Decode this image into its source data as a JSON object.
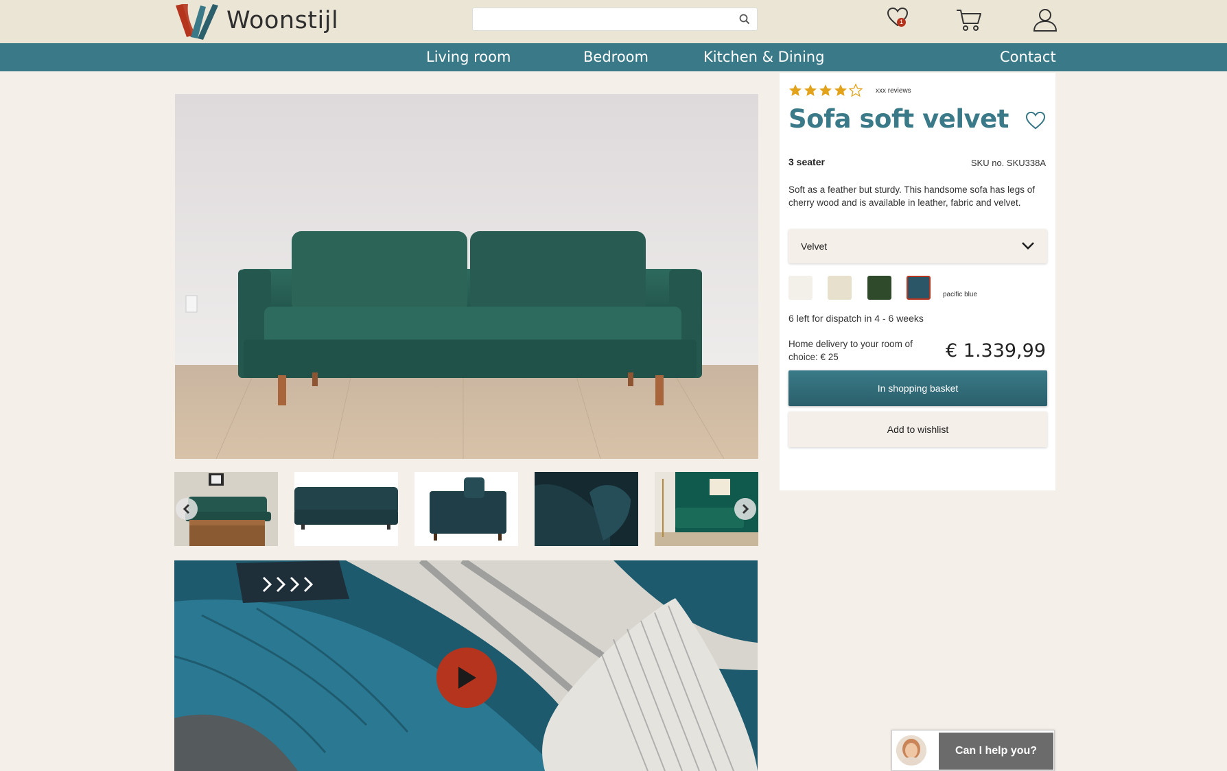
{
  "header": {
    "logo_text": "Woonstijl",
    "search": {
      "placeholder": "",
      "value": ""
    },
    "wishlist_count": "1",
    "icons": [
      "heart-icon",
      "cart-icon",
      "user-icon",
      "search-icon"
    ]
  },
  "nav": {
    "items": [
      "Living room",
      "Bedroom",
      "Kitchen & Dining",
      "Contact"
    ]
  },
  "colors": {
    "accent": "#3a7a88",
    "header_bg": "#ebe5d5",
    "page_bg": "#f4efe9",
    "alert": "#b5341d",
    "star": "#e2a21a"
  },
  "product": {
    "rating": 4,
    "rating_max": 5,
    "reviews_text": "xxx reviews",
    "title": "Sofa soft velvet",
    "variant": "3 seater",
    "sku": "SKU no. SKU338A",
    "description": "Soft as a feather but sturdy. This handsome sofa has legs of cherry wood and is available in leather, fabric and velvet.",
    "material_select": {
      "value": "Velvet"
    },
    "swatches": [
      {
        "color": "#f3efe9",
        "selected": false
      },
      {
        "color": "#e7e0cc",
        "selected": false
      },
      {
        "color": "#2f4a2a",
        "selected": false
      },
      {
        "color": "#2a5667",
        "selected": true
      }
    ],
    "selected_swatch_label": "pacific blue",
    "stock_text": "6 left for dispatch in 4 - 6 weeks",
    "delivery_text": "Home delivery to your room of choice: € 25",
    "price": "€ 1.339,99",
    "basket_button": "In shopping basket",
    "wishlist_button": "Add to wishlist"
  },
  "gallery": {
    "thumbnail_count": 5,
    "video_play_icon": "play-icon"
  },
  "chat": {
    "label": "Can I help you?"
  }
}
